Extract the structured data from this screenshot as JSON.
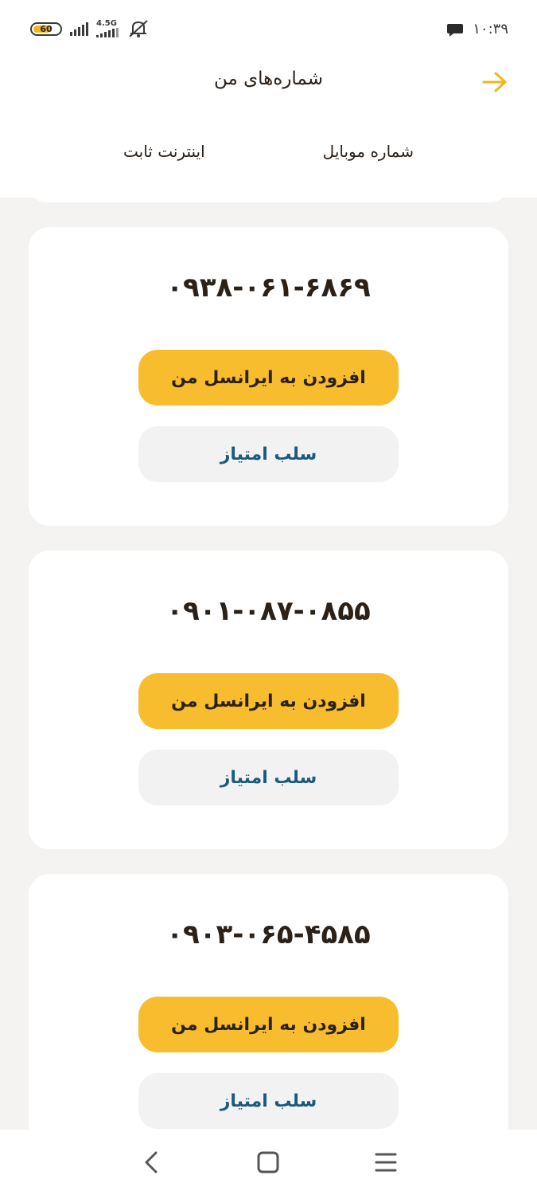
{
  "status_bar": {
    "time": "۱۰:۳۹",
    "battery": "60",
    "network": "4.5G",
    "icons": [
      "battery-icon",
      "signal-icon",
      "mute-icon",
      "chat-icon"
    ]
  },
  "header": {
    "title": "شماره‌های من",
    "back_icon": "arrow-right-icon"
  },
  "tabs": [
    {
      "label": "شماره موبایل",
      "active": true
    },
    {
      "label": "اینترنت ثابت",
      "active": false
    }
  ],
  "numbers": [
    {
      "phone": "۰۹۳۸-۰۶۱-۶۸۶۹",
      "add_label": "افزودن به ایرانسل من",
      "revoke_label": "سلب امتیاز"
    },
    {
      "phone": "۰۹۰۱-۰۸۷-۰۸۵۵",
      "add_label": "افزودن به ایرانسل من",
      "revoke_label": "سلب امتیاز"
    },
    {
      "phone": "۰۹۰۳-۰۶۵-۴۵۸۵",
      "add_label": "افزودن به ایرانسل من",
      "revoke_label": "سلب امتیاز"
    }
  ],
  "colors": {
    "accent": "#f8bd2e",
    "revoke_text": "#1a5a7a",
    "background": "#f4f3f1"
  },
  "nav_bar": {
    "icons": [
      "back-nav-icon",
      "home-nav-icon",
      "menu-nav-icon"
    ]
  }
}
